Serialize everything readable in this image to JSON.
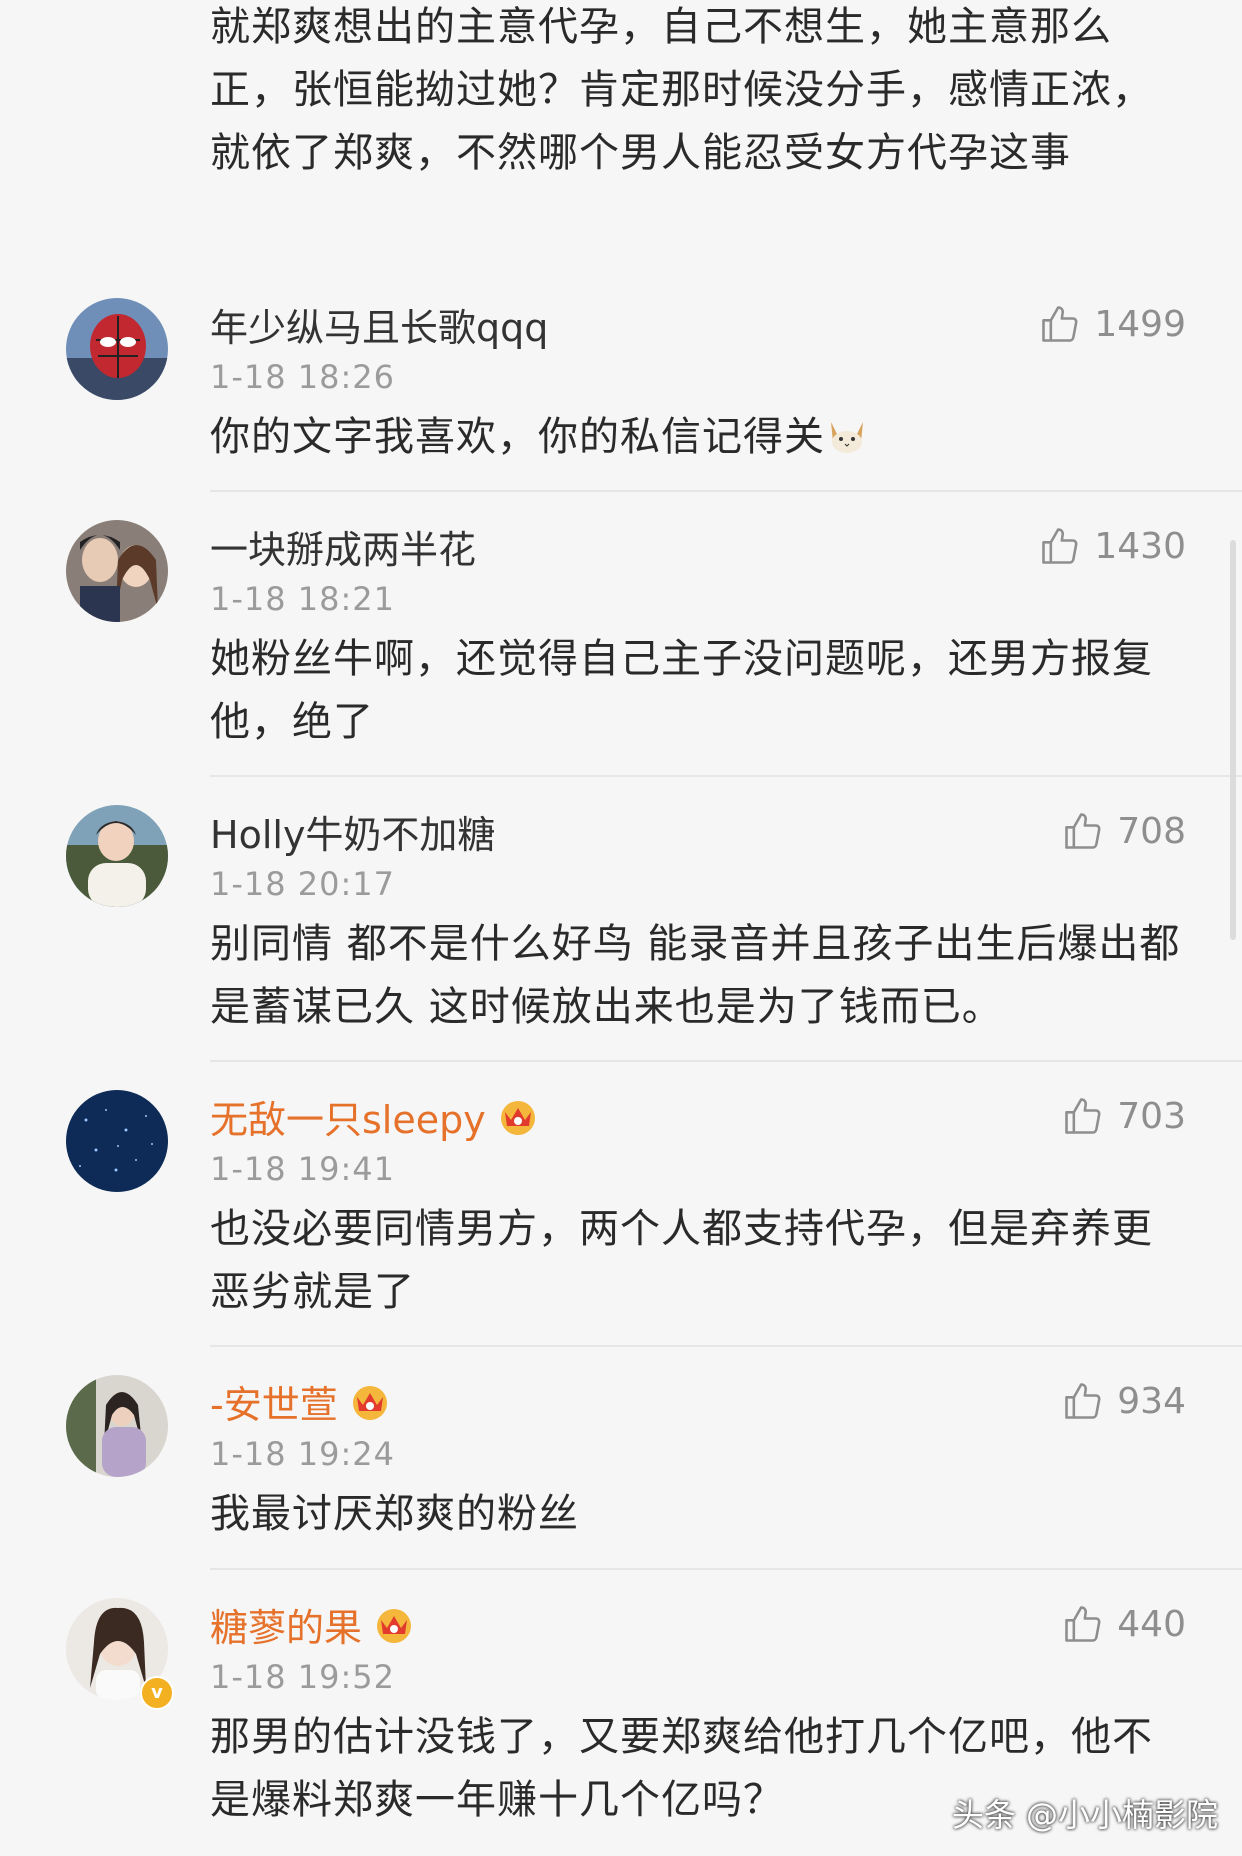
{
  "top_text": "就郑爽想出的主意代孕，自己不想生，她主意那么正，张恒能拗过她？肯定那时候没分手，感情正浓，就依了郑爽，不然哪个男人能忍受女方代孕这事",
  "comments": [
    {
      "name": "年少纵马且长歌qqq",
      "time": "1-18 18:26",
      "likes": "1499",
      "content": "你的文字我喜欢，你的私信记得关",
      "emoji": "cat-face-icon"
    },
    {
      "name": "一块掰成两半花",
      "time": "1-18 18:21",
      "likes": "1430",
      "content": "她粉丝牛啊，还觉得自己主子没问题呢，还男方报复他，绝了"
    },
    {
      "name": "Holly牛奶不加糖",
      "time": "1-18 20:17",
      "likes": "708",
      "content": "别同情 都不是什么好鸟 能录音并且孩子出生后爆出都是蓄谋已久 这时候放出来也是为了钱而已。"
    },
    {
      "name": "无敌一只sleepy",
      "time": "1-18 19:41",
      "likes": "703",
      "content": "也没必要同情男方，两个人都支持代孕，但是弃养更恶劣就是了",
      "vip": true
    },
    {
      "name": "-安世萱",
      "time": "1-18 19:24",
      "likes": "934",
      "content": "我最讨厌郑爽的粉丝",
      "vip": true
    },
    {
      "name": "糖蓼的果",
      "time": "1-18 19:52",
      "likes": "440",
      "content": "那男的估计没钱了，又要郑爽给他打几个亿吧，他不是爆料郑爽一年赚十几个亿吗？",
      "vip": true,
      "verified": true
    }
  ],
  "watermark": "头条 @小小楠影院",
  "colors": {
    "vip_name": "#e5712a",
    "time": "#9b9b9b",
    "text": "#2a2a2a",
    "background": "#f6f6f6",
    "verified_badge": "#f3b021"
  }
}
